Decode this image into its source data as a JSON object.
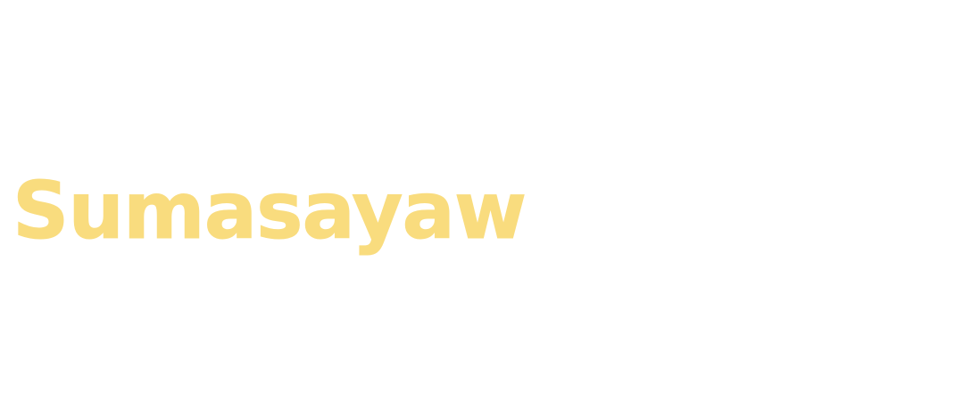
{
  "title": "Sumasayaw",
  "colors": {
    "text": "#f9dc7e",
    "background": "#ffffff"
  }
}
